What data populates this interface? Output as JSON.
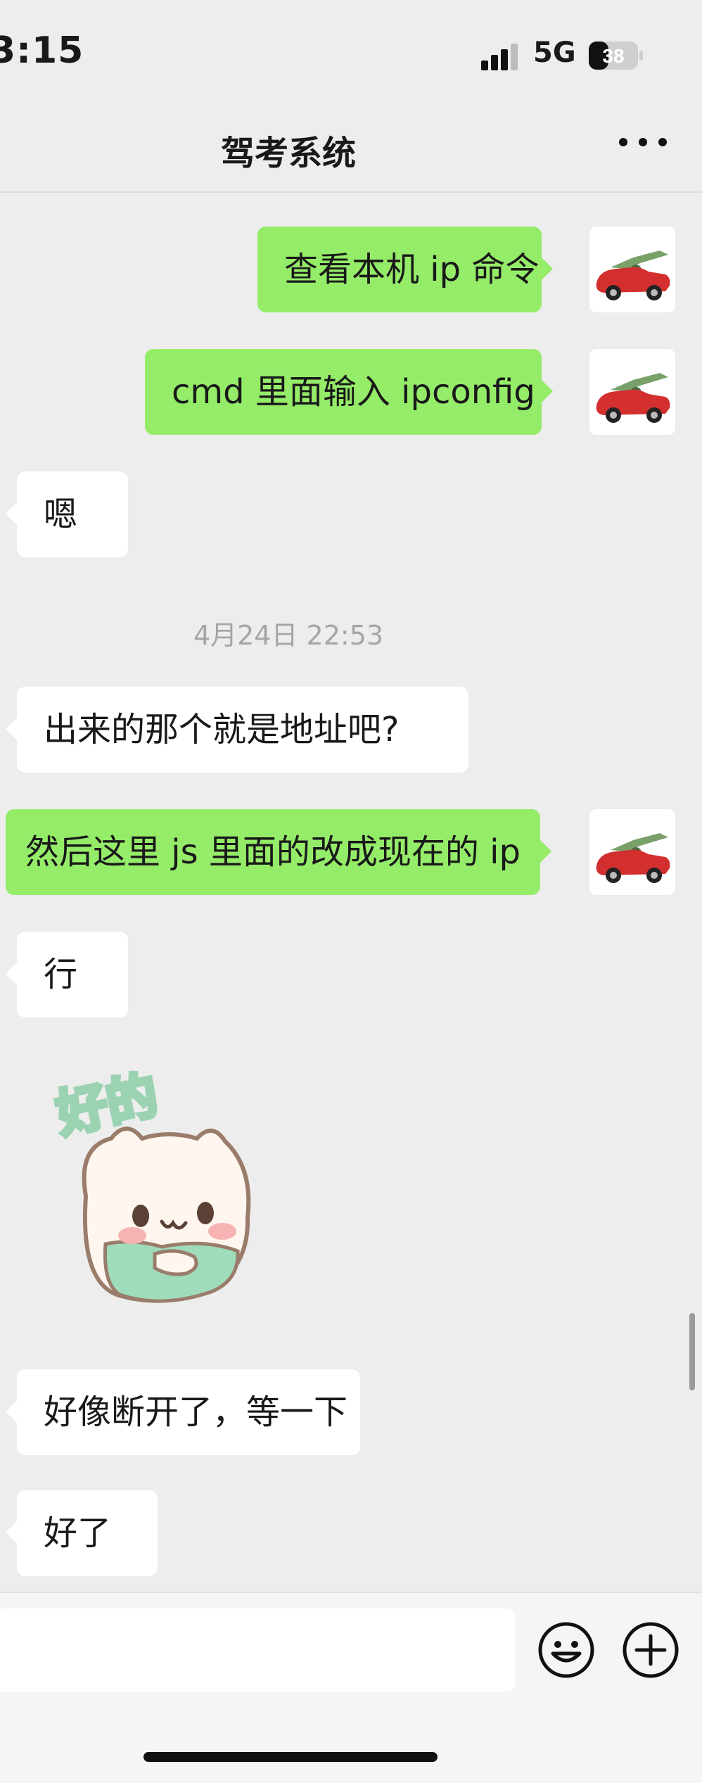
{
  "status_bar": {
    "time": "3:15",
    "network": "5G",
    "battery": "38",
    "icons": [
      "signal-icon",
      "battery-icon"
    ]
  },
  "nav": {
    "title": "驾考系统",
    "more_icon": "more-icon"
  },
  "messages": [
    {
      "side": "out",
      "text": "查看本机 ip 命令"
    },
    {
      "side": "out",
      "text": "cmd  里面输入 ipconfig"
    },
    {
      "side": "in",
      "text": "嗯"
    },
    {
      "type": "timestamp",
      "text": "4月24日 22:53"
    },
    {
      "side": "in",
      "text": "出来的那个就是地址吧?"
    },
    {
      "side": "out",
      "text": "然后这里 js 里面的改成现在的 ip"
    },
    {
      "side": "in",
      "text": "行"
    },
    {
      "side": "in",
      "type": "sticker",
      "text": "好的"
    },
    {
      "side": "in",
      "text": "好像断开了，等一下"
    },
    {
      "side": "in",
      "text": "好了"
    }
  ],
  "composer": {
    "input_value": "",
    "emoji_icon": "emoji-icon",
    "add_icon": "add-icon"
  },
  "colors": {
    "background": "#ededed",
    "outgoing_bubble": "#95ec69",
    "incoming_bubble": "#ffffff",
    "timestamp": "#a6a6a6"
  }
}
